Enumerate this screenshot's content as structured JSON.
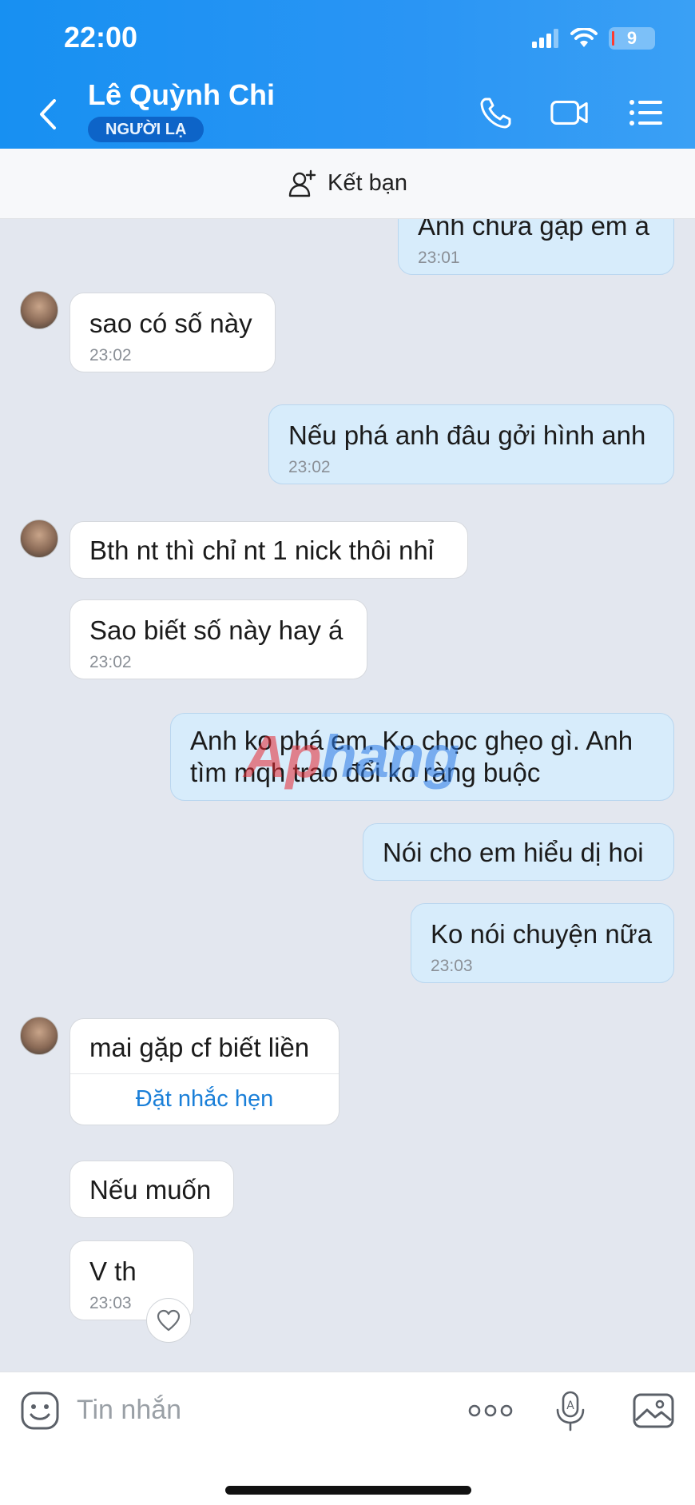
{
  "status_bar": {
    "time": "22:00",
    "battery": "9"
  },
  "header": {
    "contact_name": "Lê Quỳnh Chi",
    "badge": "NGƯỜI LẠ",
    "icons": [
      "back-icon",
      "phone-icon",
      "video-icon",
      "menu-icon"
    ]
  },
  "friend_bar": {
    "label": "Kết bạn",
    "icon": "add-friend-icon"
  },
  "messages": [
    {
      "dir": "out",
      "text": "Anh chưa gặp em á",
      "time": "23:01"
    },
    {
      "dir": "in",
      "text": "sao có số này",
      "time": "23:02"
    },
    {
      "dir": "out",
      "text": "Nếu phá anh đâu gởi hình anh",
      "time": "23:02"
    },
    {
      "dir": "in",
      "text": "Bth nt thì chỉ nt 1 nick thôi nhỉ",
      "time": ""
    },
    {
      "dir": "in",
      "text": "Sao biết số này hay á",
      "time": "23:02"
    },
    {
      "dir": "out",
      "text": "Anh ko phá em. Ko chọc ghẹo gì. Anh tìm mqh trao đổi ko ràng buộc",
      "time": ""
    },
    {
      "dir": "out",
      "text": "Nói cho em hiểu dị hoi",
      "time": ""
    },
    {
      "dir": "out",
      "text": "Ko nói chuyện nữa",
      "time": "23:03"
    },
    {
      "dir": "in",
      "text": "mai gặp cf biết liền",
      "time": "",
      "action": "Đặt nhắc hẹn"
    },
    {
      "dir": "in",
      "text": "Nếu muốn",
      "time": ""
    },
    {
      "dir": "in",
      "text": "V th",
      "time": "23:03"
    }
  ],
  "watermark": {
    "part1": "Ap",
    "part2": "hang"
  },
  "input_bar": {
    "placeholder": "Tin nhắn",
    "icons": [
      "emoji-icon",
      "more-icon",
      "voice-icon",
      "image-icon"
    ]
  },
  "colors": {
    "header": "#1790f2",
    "bubble_out": "#d7ecfb",
    "bubble_in": "#ffffff",
    "link": "#1a7fd8"
  }
}
